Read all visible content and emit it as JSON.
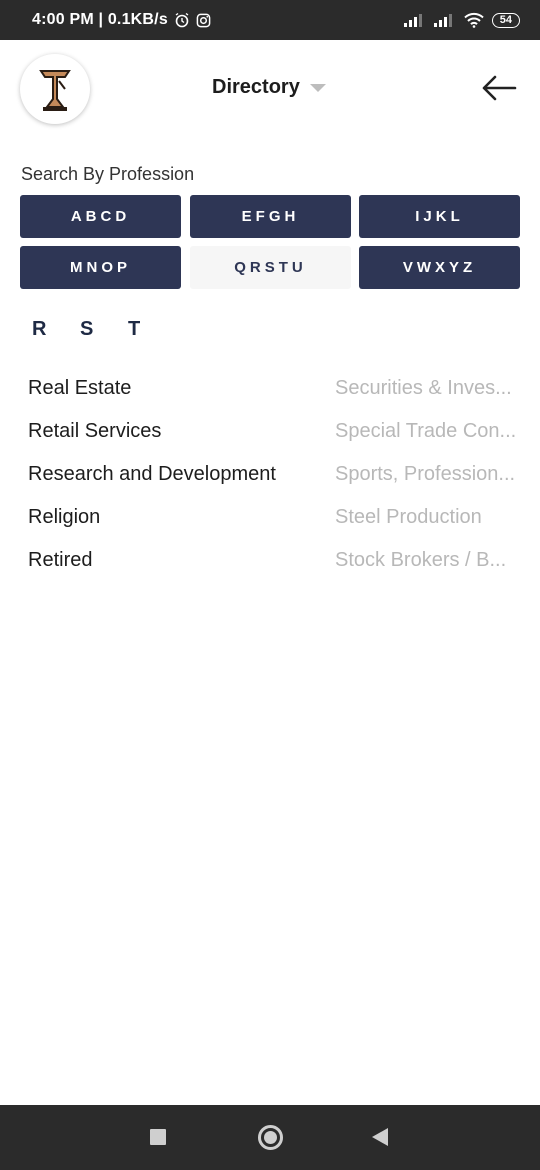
{
  "status_bar": {
    "time": "4:00 PM | 0.1KB/s",
    "battery": "54"
  },
  "header": {
    "title": "Directory"
  },
  "search": {
    "label": "Search By Profession",
    "groups": [
      {
        "label": "ABCD",
        "active": false
      },
      {
        "label": "EFGH",
        "active": false
      },
      {
        "label": "IJKL",
        "active": false
      },
      {
        "label": "MNOP",
        "active": false
      },
      {
        "label": "QRSTU",
        "active": true
      },
      {
        "label": "VWXYZ",
        "active": false
      }
    ]
  },
  "sub_letters": [
    "R",
    "S",
    "T"
  ],
  "professions": {
    "left": [
      "Real Estate",
      "Retail Services",
      "Research and Development",
      "Religion",
      "Retired"
    ],
    "right": [
      "Securities & Inves...",
      "Special Trade Con...",
      "Sports, Profession...",
      "Steel Production",
      "Stock Brokers / B..."
    ]
  },
  "colors": {
    "accent": "#2e3655",
    "muted_text": "#b8b8b8"
  }
}
